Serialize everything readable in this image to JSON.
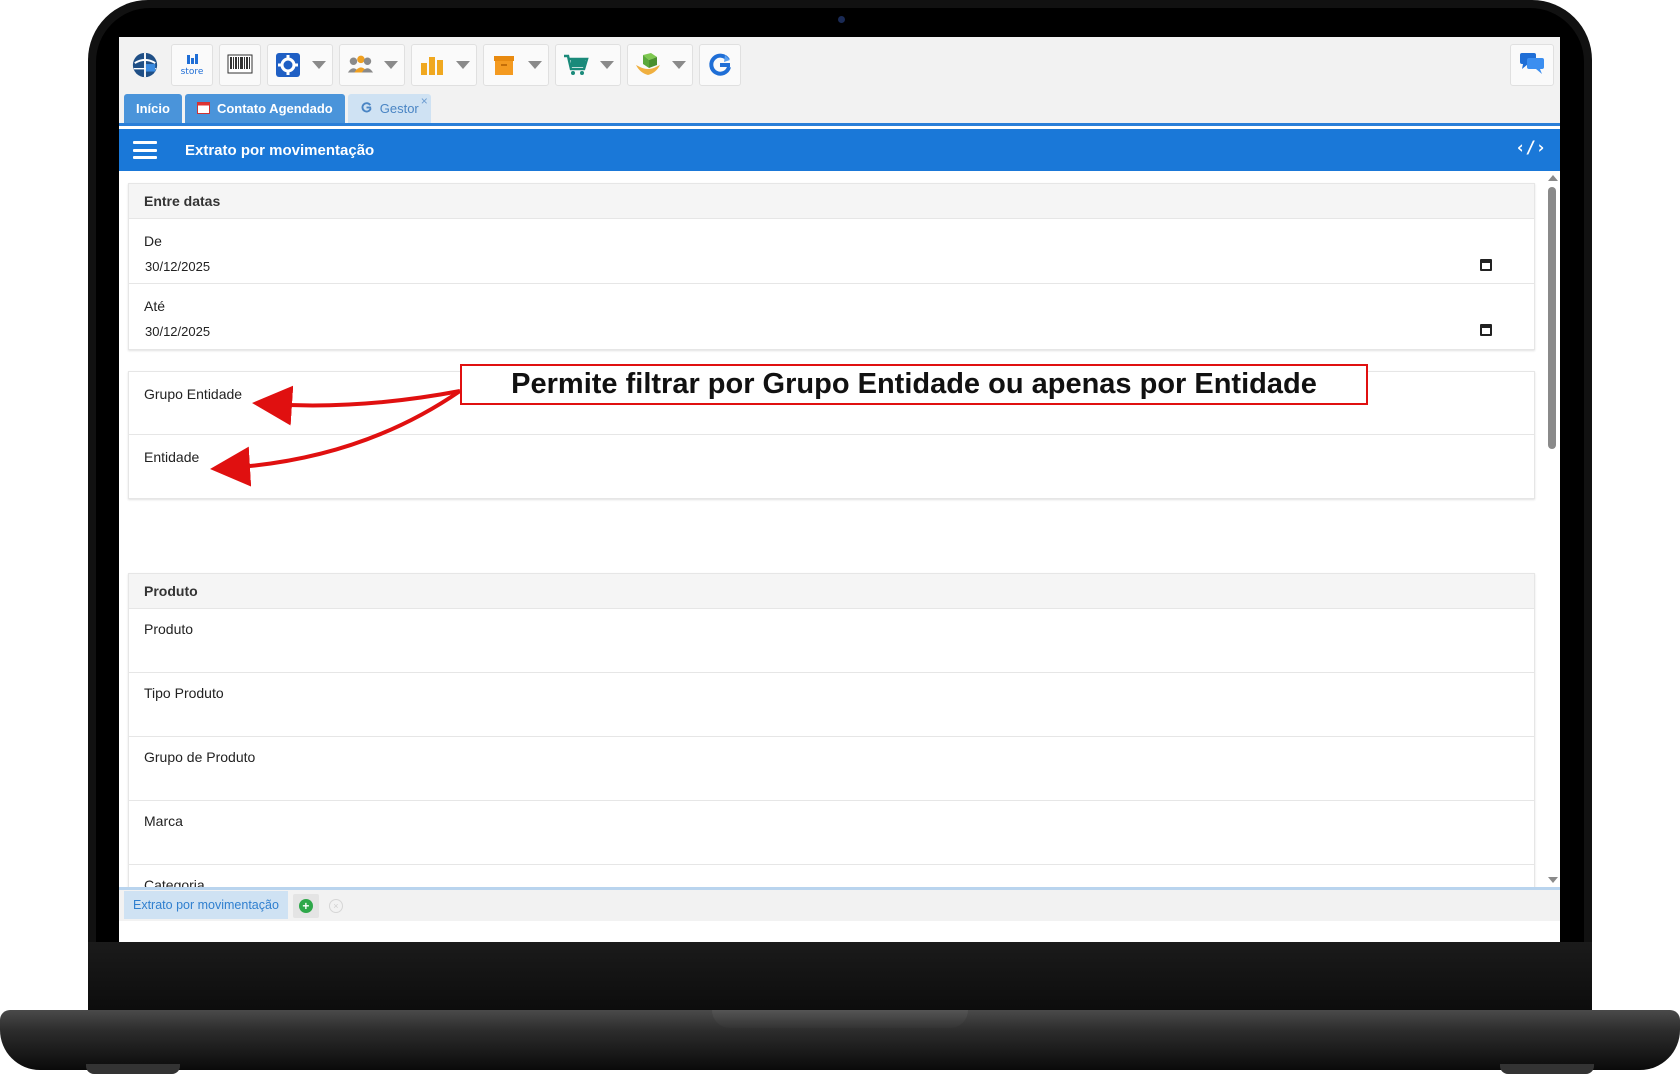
{
  "toolbar": {
    "buttons": [
      {
        "name": "globe-logo-button",
        "icon": "globe-icon"
      },
      {
        "name": "store-button",
        "icon": "store-icon",
        "label": "ıllı\nstore"
      },
      {
        "name": "boleto-button",
        "icon": "barcode-icon"
      },
      {
        "name": "settings-button",
        "icon": "gear-icon",
        "dropdown": true
      },
      {
        "name": "users-button",
        "icon": "users-icon",
        "dropdown": true
      },
      {
        "name": "reports-button",
        "icon": "bar-chart-icon",
        "dropdown": true
      },
      {
        "name": "inventory-button",
        "icon": "box-icon",
        "dropdown": true
      },
      {
        "name": "cart-button",
        "icon": "cart-icon",
        "dropdown": true
      },
      {
        "name": "products-button",
        "icon": "hand-box-icon",
        "dropdown": true
      },
      {
        "name": "refresh-button",
        "icon": "refresh-icon"
      }
    ],
    "chat_icon": "chat-icon"
  },
  "tabs": [
    {
      "label": "Início",
      "active": false
    },
    {
      "label": "Contato Agendado",
      "icon": "calendar-icon",
      "active": false
    },
    {
      "label": "Gestor",
      "icon": "refresh-icon",
      "active": true,
      "close": "×"
    }
  ],
  "header": {
    "title": "Extrato por movimentação",
    "menu_icon": "hamburger-icon",
    "code_icon_glyph": "‹/›"
  },
  "panels": {
    "dates": {
      "title": "Entre datas",
      "from_label": "De",
      "from_value": "30/12/2025",
      "to_label": "Até",
      "to_value": "30/12/2025"
    },
    "entity": {
      "group_label": "Grupo Entidade",
      "entity_label": "Entidade"
    },
    "product": {
      "title": "Produto",
      "fields": [
        "Produto",
        "Tipo Produto",
        "Grupo de Produto",
        "Marca",
        "Categoria"
      ]
    }
  },
  "bottom_tabs": {
    "current": "Extrato por movimentação",
    "add": "+",
    "close_all": "×"
  },
  "annotation": {
    "text": "Permite filtrar por Grupo Entidade ou apenas por Entidade",
    "color": "#e01010"
  },
  "colors": {
    "header": "#1a78d8",
    "tab": "#4a94da",
    "tab_active": "#cfe2f3"
  }
}
